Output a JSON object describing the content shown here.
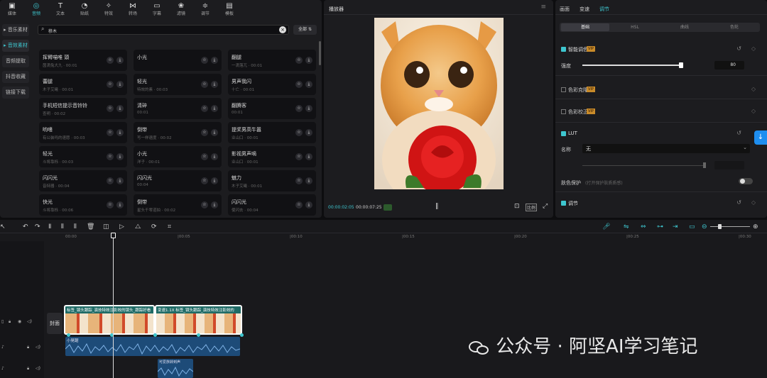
{
  "left_panel": {
    "tabs": [
      {
        "label": "媒体",
        "icon": "media-icon"
      },
      {
        "label": "音频",
        "icon": "audio-icon"
      },
      {
        "label": "文本",
        "icon": "text-icon"
      },
      {
        "label": "贴纸",
        "icon": "sticker-icon"
      },
      {
        "label": "特效",
        "icon": "effects-icon"
      },
      {
        "label": "转场",
        "icon": "transition-icon"
      },
      {
        "label": "字幕",
        "icon": "caption-icon"
      },
      {
        "label": "滤镜",
        "icon": "filter-icon"
      },
      {
        "label": "调节",
        "icon": "adjust-icon"
      },
      {
        "label": "模板",
        "icon": "template-icon"
      }
    ],
    "active_tab": "音频",
    "side_items": [
      "▸ 音乐素材",
      "▸ 音效素材",
      "音频提取",
      "抖音收藏",
      "链接下载"
    ],
    "search": {
      "value": "移木",
      "filter_label": "全部"
    },
    "sounds": [
      [
        "挥臂喵唯 頭",
        "小光",
        "翻腿"
      ],
      [
        "蕾腿",
        "轻光",
        "男声我闪"
      ],
      [
        "手机短信提示音铃铃",
        "清碎",
        "翻腾客"
      ],
      [
        "哟嗜",
        "倒带",
        "提奖男高牛嚣"
      ],
      [
        "轻光",
        "小光",
        "影视男声嘀"
      ],
      [
        "闪闪光",
        "闪闪光",
        "魅力"
      ],
      [
        "快光",
        "倒带",
        "闪闪光"
      ]
    ],
    "sound_subs": [
      [
        "茵滴兔大九 · 00:01",
        "",
        "一滴落兀 · 00:01"
      ],
      [
        "木子艾曦 · 00:01",
        "特效的素 · 00:03",
        "十亡 · 00:01"
      ],
      [
        "查明 · 00:02",
        "00:01",
        "00:01"
      ],
      [
        "有公装吗的速愿 · 00:03",
        "写一样速度 · 00:02",
        "业山口 · 00:01"
      ],
      [
        "斗将靠栎 · 00:03",
        "洋子 · 00:01",
        "业山口 · 00:01"
      ],
      [
        "音特器 · 00:04",
        "00:04",
        "木子艾曦 · 00:01"
      ],
      [
        "斗将靠栎 · 00:06",
        "星头千零道拍 · 00:02",
        "使闪去 · 00:04"
      ]
    ]
  },
  "player": {
    "title": "播放器",
    "current_time": "00:00:02:05",
    "total_time": "00:00:07:25",
    "ratio_label": "比例"
  },
  "right_panel": {
    "tabs": [
      "画面",
      "变速",
      "调节"
    ],
    "active_tab": "调节",
    "subtabs": [
      "基础",
      "HSL",
      "曲线",
      "色轮"
    ],
    "sections": {
      "smart_color": "智能调色",
      "intensity_label": "强度",
      "intensity_value": "80",
      "color_grade": "色彩克隆",
      "color_correct": "色彩校正",
      "lut": "LUT",
      "name_label": "名称",
      "name_value": "无",
      "skin_label": "肤色保护",
      "skin_hint": "(打开保护肤质质感)",
      "adjust": "调节",
      "vip": "VIP"
    }
  },
  "timeline": {
    "ruler": [
      "00:00",
      "|00:05",
      "|00:10",
      "|00:15",
      "|00:20",
      "|00:25",
      "|00:30"
    ],
    "cover_label": "封面",
    "clip1_label": "标签_镜头跟踪_演技特效注影效的镜头_跟踪好看",
    "clip2_label": "变速1.1X  标签_镜头跟踪_演技特效注影效的",
    "audio1_label": "小晃踞",
    "audio2_label": "可爱族转到声"
  },
  "watermark": "公众号 · 阿坚AI学习笔记"
}
